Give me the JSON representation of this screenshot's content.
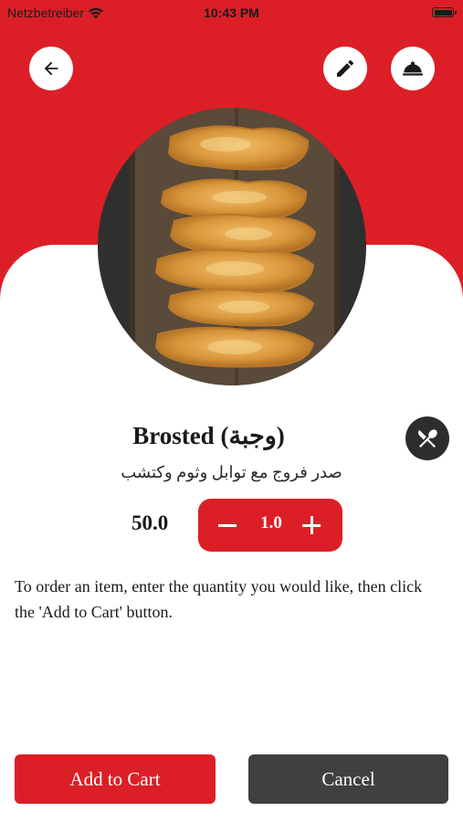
{
  "status_bar": {
    "carrier": "Netzbetreiber",
    "time": "10:43 PM"
  },
  "icons": {
    "back": "arrow-left-icon",
    "edit": "pencil-icon",
    "menu": "room-service-icon",
    "utensils": "fork-knife-icon",
    "wifi": "wifi-icon",
    "battery": "battery-icon"
  },
  "product": {
    "title": "Brosted (وجبة)",
    "description": "صدر فروج مع توابل وثوم وكتشب",
    "price": "50.0",
    "quantity": "1.0"
  },
  "instructions": "To order an item, enter the quantity you would like, then click the 'Add to Cart' button.",
  "actions": {
    "add_to_cart": "Add to Cart",
    "cancel": "Cancel"
  },
  "colors": {
    "accent": "#dc1f26",
    "dark_button": "#404040",
    "background": "#ffffff"
  }
}
